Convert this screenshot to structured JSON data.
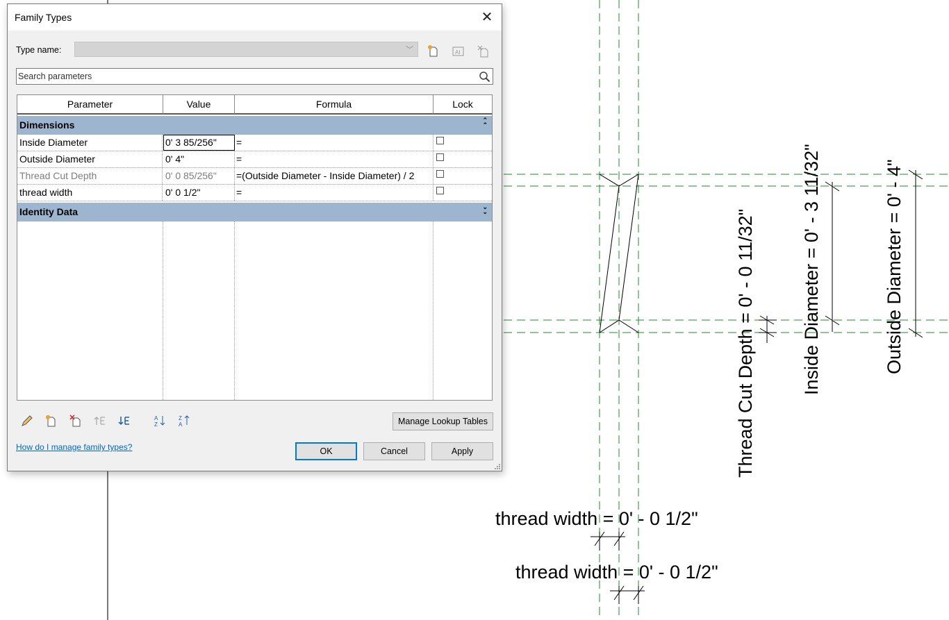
{
  "dialog": {
    "title": "Family Types",
    "type_name_label": "Type name:",
    "type_name_value": "",
    "search_placeholder": "Search parameters",
    "columns": [
      "Parameter",
      "Value",
      "Formula",
      "Lock"
    ],
    "groups": [
      {
        "title": "Dimensions",
        "expanded": true,
        "rows": [
          {
            "parameter": "Inside Diameter",
            "value": "0'  3 85/256\"",
            "formula": "=",
            "locked": false,
            "grayed": false
          },
          {
            "parameter": "Outside Diameter",
            "value": "0'  4\"",
            "formula": "=",
            "locked": false,
            "grayed": false
          },
          {
            "parameter": "Thread Cut Depth",
            "value": "0'  0 85/256\"",
            "formula": "=(Outside Diameter - Inside Diameter) / 2",
            "locked": false,
            "grayed": true
          },
          {
            "parameter": "thread width",
            "value": "0'  0 1/2\"",
            "formula": "=",
            "locked": false,
            "grayed": false
          }
        ]
      },
      {
        "title": "Identity Data",
        "expanded": false,
        "rows": []
      }
    ],
    "manage_lookup_label": "Manage Lookup Tables",
    "help_link": "How do I manage family types?",
    "ok_label": "OK",
    "cancel_label": "Cancel",
    "apply_label": "Apply",
    "icons": [
      "pencil-icon",
      "new-parameter-icon",
      "delete-parameter-icon",
      "move-up-icon",
      "move-down-icon",
      "sort-ascending-icon",
      "sort-descending-icon",
      "new-type-icon",
      "rename-type-icon",
      "delete-type-icon",
      "search-icon",
      "close-icon"
    ]
  },
  "drawing": {
    "labels": {
      "thread_cut_depth": "Thread Cut Depth = 0' - 0 11/32\"",
      "inside_diameter": "Inside Diameter = 0' - 3 11/32\"",
      "outside_diameter": "Outside Diameter = 0' - 4\"",
      "thread_width_1": "thread width = 0' - 0 1/2\"",
      "thread_width_2": "thread width = 0' - 0 1/2\""
    },
    "colors": {
      "reference_plane": "#228b22",
      "geometry": "#000000"
    }
  }
}
